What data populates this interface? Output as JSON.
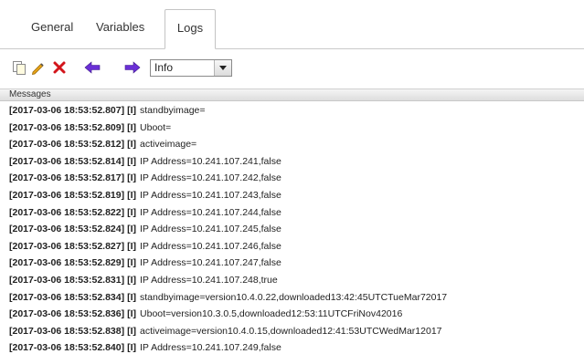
{
  "tabs": {
    "general": "General",
    "variables": "Variables",
    "logs": "Logs"
  },
  "toolbar": {
    "icons": [
      "copy-icon",
      "pencil-icon",
      "delete-icon",
      "arrow-left-icon",
      "arrow-right-icon"
    ],
    "level_select": "Info"
  },
  "log": {
    "header": "Messages",
    "lines": [
      {
        "ts": "[2017-03-06 18:53:52.807]",
        "lvl": "[I]",
        "msg": "standbyimage="
      },
      {
        "ts": "[2017-03-06 18:53:52.809]",
        "lvl": "[I]",
        "msg": "Uboot="
      },
      {
        "ts": "[2017-03-06 18:53:52.812]",
        "lvl": "[I]",
        "msg": "activeimage="
      },
      {
        "ts": "[2017-03-06 18:53:52.814]",
        "lvl": "[I]",
        "msg": "IP Address=10.241.107.241,false"
      },
      {
        "ts": "[2017-03-06 18:53:52.817]",
        "lvl": "[I]",
        "msg": "IP Address=10.241.107.242,false"
      },
      {
        "ts": "[2017-03-06 18:53:52.819]",
        "lvl": "[I]",
        "msg": "IP Address=10.241.107.243,false"
      },
      {
        "ts": "[2017-03-06 18:53:52.822]",
        "lvl": "[I]",
        "msg": "IP Address=10.241.107.244,false"
      },
      {
        "ts": "[2017-03-06 18:53:52.824]",
        "lvl": "[I]",
        "msg": "IP Address=10.241.107.245,false"
      },
      {
        "ts": "[2017-03-06 18:53:52.827]",
        "lvl": "[I]",
        "msg": "IP Address=10.241.107.246,false"
      },
      {
        "ts": "[2017-03-06 18:53:52.829]",
        "lvl": "[I]",
        "msg": "IP Address=10.241.107.247,false"
      },
      {
        "ts": "[2017-03-06 18:53:52.831]",
        "lvl": "[I]",
        "msg": "IP Address=10.241.107.248,true"
      },
      {
        "ts": "[2017-03-06 18:53:52.834]",
        "lvl": "[I]",
        "msg": "standbyimage=version10.4.0.22,downloaded13:42:45UTCTueMar72017"
      },
      {
        "ts": "[2017-03-06 18:53:52.836]",
        "lvl": "[I]",
        "msg": "Uboot=version10.3.0.5,downloaded12:53:11UTCFriNov42016"
      },
      {
        "ts": "[2017-03-06 18:53:52.838]",
        "lvl": "[I]",
        "msg": "activeimage=version10.4.0.15,downloaded12:41:53UTCWedMar12017"
      },
      {
        "ts": "[2017-03-06 18:53:52.840]",
        "lvl": "[I]",
        "msg": "IP Address=10.241.107.249,false"
      }
    ]
  }
}
